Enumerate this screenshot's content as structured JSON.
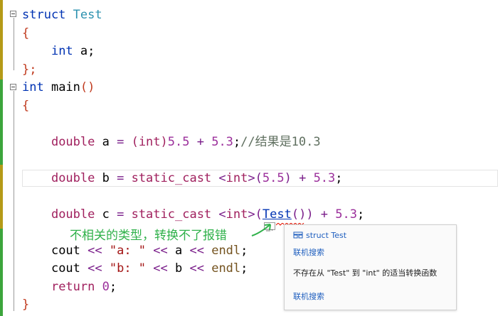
{
  "code": {
    "line1": {
      "kw": "struct",
      "name": "Test"
    },
    "line2": {
      "brace": "{"
    },
    "line3": {
      "type": "int",
      "rest": " a;"
    },
    "line4": {
      "brace": "};"
    },
    "line5": {
      "type": "int",
      "name": " main",
      "paren": "()"
    },
    "line6": {
      "brace": "{"
    },
    "line8": {
      "type": "double",
      "var": " a ",
      "eq": "=",
      "cast": " (int)",
      "num1": "5.5",
      "plus": " + ",
      "num2": "5.3",
      "semi": ";",
      "comment": "//结果是10.3"
    },
    "line10": {
      "type": "double",
      "var": " b ",
      "eq": "=",
      "cast": " static_cast",
      "lt": " <",
      "ctype": "int",
      "gt": ">",
      "open": "(",
      "num1": "5.5",
      "close": ")",
      "plus": " + ",
      "num2": "5.3",
      "semi": ";"
    },
    "line12": {
      "type": "double",
      "var": " c ",
      "eq": "=",
      "cast": " static_cast",
      "lt": " <",
      "ctype": "int",
      "gt": ">",
      "open": "(",
      "test": "Test",
      "call": "()",
      "close": ")",
      "plus": " + ",
      "num2": "5.3",
      "semi": ";"
    },
    "line14": {
      "cout": "cout",
      "op1": " << ",
      "str": "\"a: \"",
      "op2": " << ",
      "var": "a",
      "op3": " << ",
      "endl": "endl",
      "semi": ";"
    },
    "line15": {
      "cout": "cout",
      "op1": " << ",
      "str": "\"b: \"",
      "op2": " << ",
      "var": "b",
      "op3": " << ",
      "endl": "endl",
      "semi": ";"
    },
    "line16": {
      "ret": "return",
      "num": " 0",
      "semi": ";"
    },
    "line17": {
      "brace": "}"
    }
  },
  "annotation": "不相关的类型，转换不了报错",
  "tooltip": {
    "struct_kw": "struct",
    "struct_name": "Test",
    "search1": "联机搜索",
    "message": "不存在从 \"Test\" 到 \"int\" 的适当转换函数",
    "search2": "联机搜索"
  },
  "colors": {
    "gutter_green": "#3ca53c",
    "gutter_yellow": "#b59a17",
    "annotation_green": "#2fb14a"
  }
}
